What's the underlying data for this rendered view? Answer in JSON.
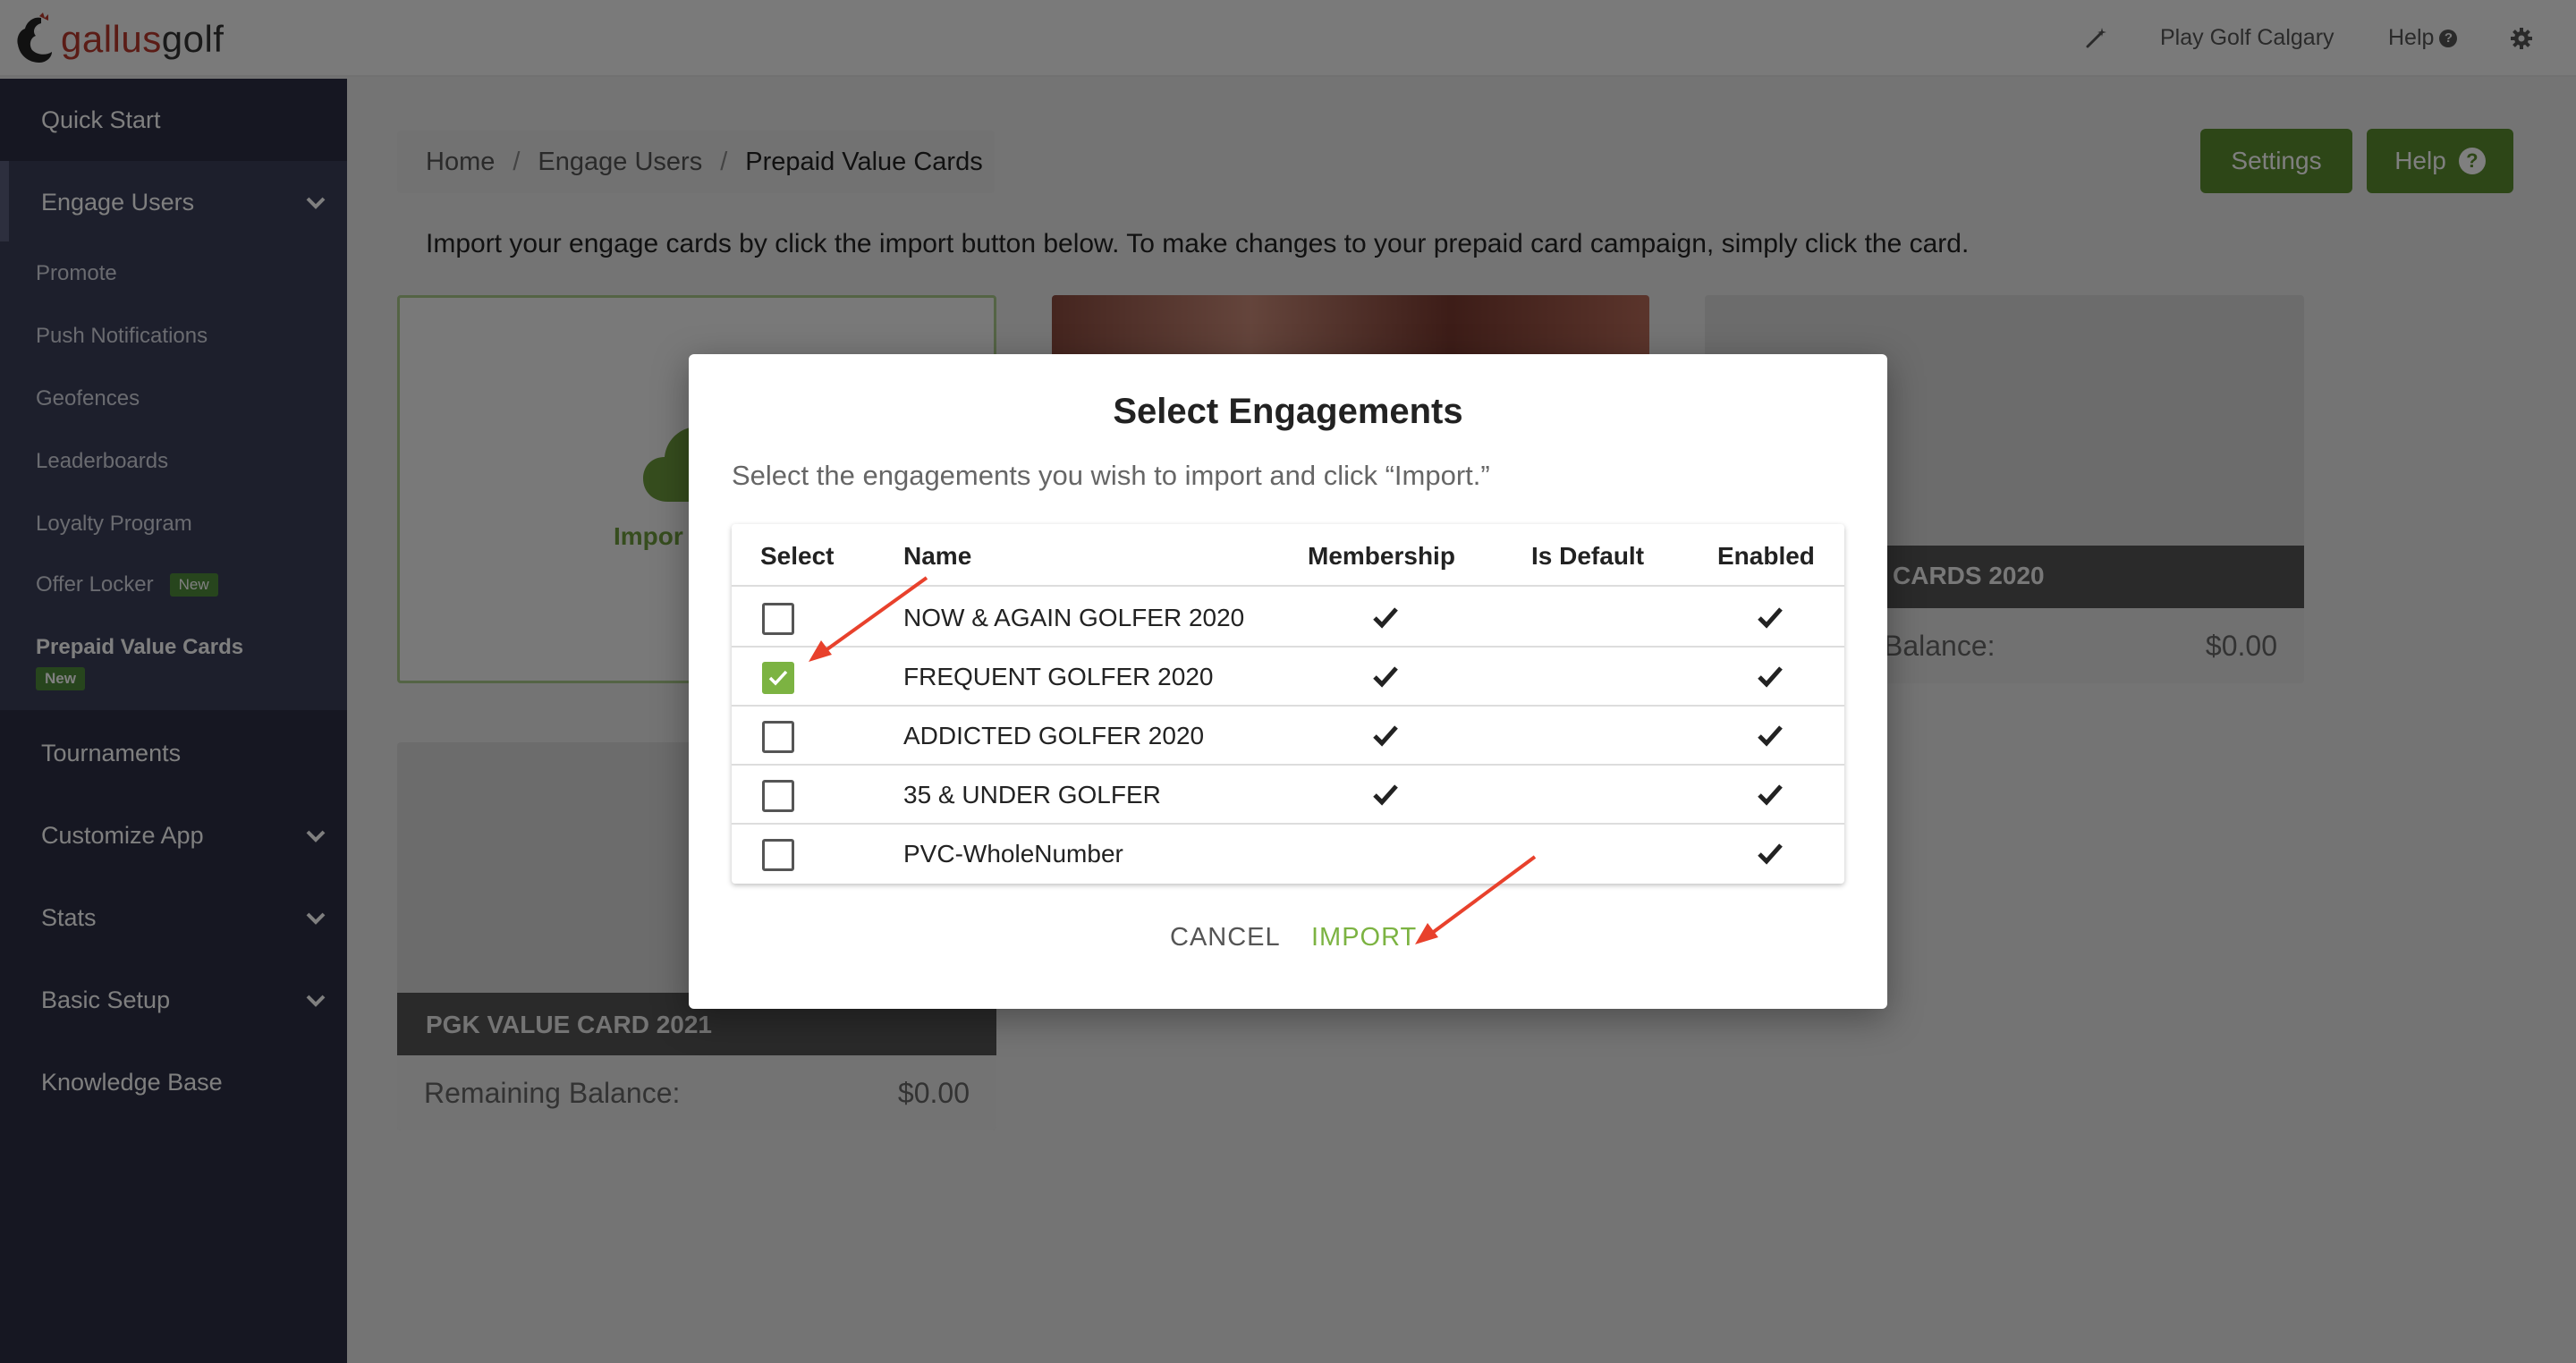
{
  "topbar": {
    "brand_part1": "gallus",
    "brand_part2": "golf",
    "location": "Play Golf Calgary",
    "help": "Help"
  },
  "sidebar": {
    "quick_start": "Quick Start",
    "engage_users": "Engage Users",
    "sub_items": [
      "Promote",
      "Push Notifications",
      "Geofences",
      "Leaderboards",
      "Loyalty Program",
      "Offer Locker",
      "Prepaid Value Cards"
    ],
    "new_badge": "New",
    "tournaments": "Tournaments",
    "customize_app": "Customize App",
    "stats": "Stats",
    "basic_setup": "Basic Setup",
    "knowledge_base": "Knowledge Base"
  },
  "main": {
    "breadcrumb": [
      "Home",
      "Engage Users",
      "Prepaid Value Cards"
    ],
    "breadcrumb_sep": "/",
    "settings_label": "Settings",
    "help_label": "Help",
    "intro": "Import your engage cards by click the import button below. To make changes to your prepaid card campaign, simply click the card.",
    "import_card_label": "Impor",
    "card3_title": "CARDS 2020",
    "card3_balance_label": "Balance:",
    "card3_balance_value": "$0.00",
    "card4_title": "PGK VALUE CARD 2021",
    "card4_balance_label": "Remaining Balance:",
    "card4_balance_value": "$0.00"
  },
  "modal": {
    "title": "Select Engagements",
    "description": "Select the engagements you wish to import and click “Import.”",
    "columns": [
      "Select",
      "Name",
      "Membership",
      "Is Default",
      "Enabled"
    ],
    "rows": [
      {
        "name": "NOW & AGAIN GOLFER 2020",
        "selected": false,
        "membership": true,
        "is_default": false,
        "enabled": true
      },
      {
        "name": "FREQUENT GOLFER 2020",
        "selected": true,
        "membership": true,
        "is_default": false,
        "enabled": true
      },
      {
        "name": "ADDICTED GOLFER 2020",
        "selected": false,
        "membership": true,
        "is_default": false,
        "enabled": true
      },
      {
        "name": "35 & UNDER GOLFER",
        "selected": false,
        "membership": true,
        "is_default": false,
        "enabled": true
      },
      {
        "name": "PVC-WholeNumber",
        "selected": false,
        "membership": false,
        "is_default": false,
        "enabled": true
      }
    ],
    "cancel_label": "CANCEL",
    "import_label": "IMPORT"
  },
  "colors": {
    "accent_green": "#7cb342",
    "button_green": "#5a8c2f",
    "sidebar_bg": "#2c2f45",
    "annotation_arrow": "#e8412c"
  }
}
